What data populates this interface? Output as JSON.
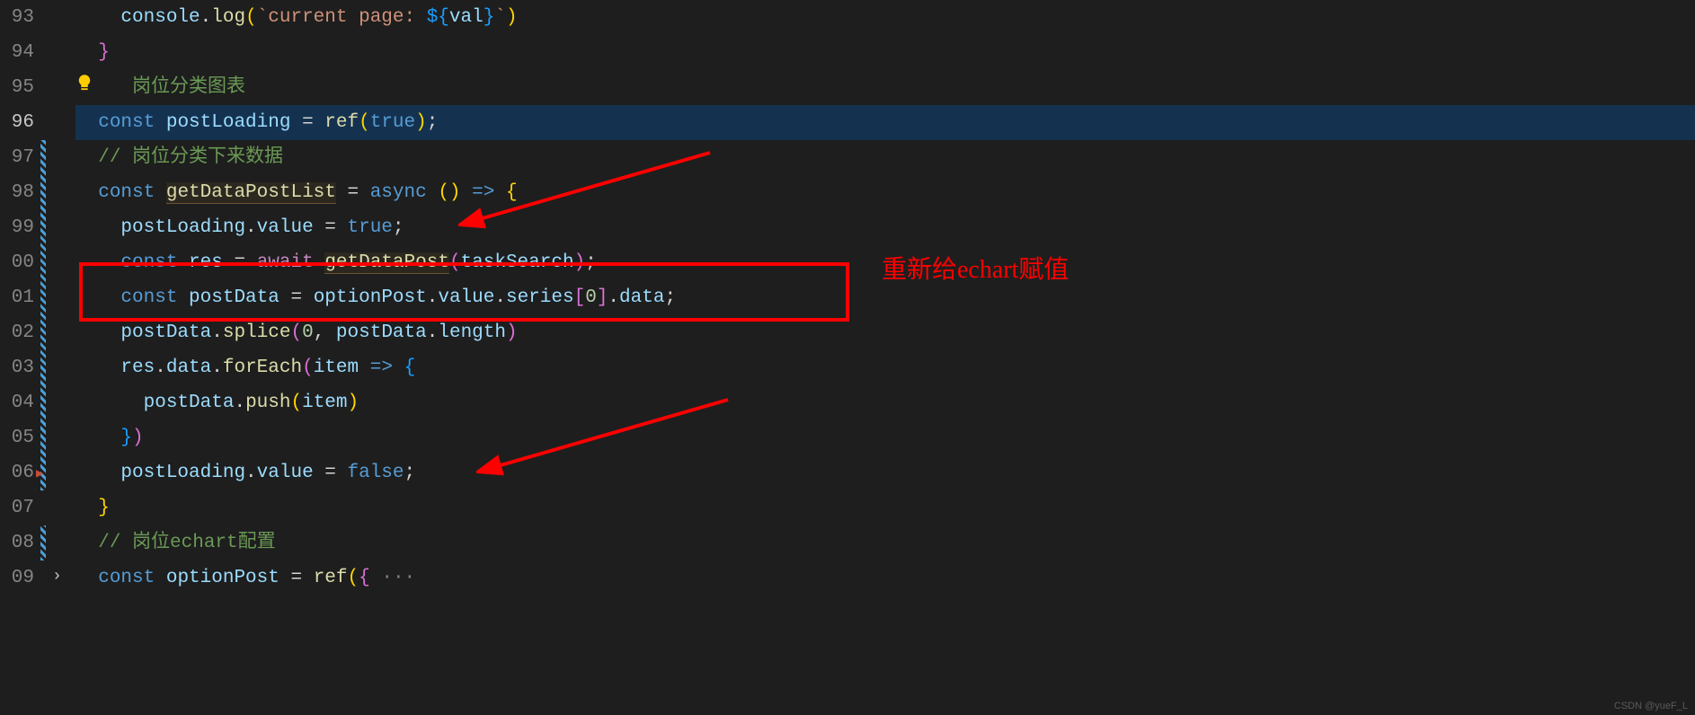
{
  "lines": [
    {
      "num": "93",
      "indent": "    ",
      "tokens": [
        {
          "t": "var",
          "v": "console"
        },
        {
          "t": "punct",
          "v": "."
        },
        {
          "t": "func",
          "v": "log"
        },
        {
          "t": "punct-yellow",
          "v": "("
        },
        {
          "t": "string",
          "v": "`current page: "
        },
        {
          "t": "punct-blue",
          "v": "${"
        },
        {
          "t": "var",
          "v": "val"
        },
        {
          "t": "punct-blue",
          "v": "}"
        },
        {
          "t": "string",
          "v": "`"
        },
        {
          "t": "punct-yellow",
          "v": ")"
        }
      ]
    },
    {
      "num": "94",
      "indent": "  ",
      "tokens": [
        {
          "t": "punct-pink",
          "v": "}"
        }
      ]
    },
    {
      "num": "95",
      "indent": "  ",
      "tokens": [
        {
          "t": "comment",
          "v": "   岗位分类图表"
        }
      ]
    },
    {
      "num": "96",
      "indent": "  ",
      "highlighted": true,
      "tokens": [
        {
          "t": "const",
          "v": "const"
        },
        {
          "t": "default",
          "v": " "
        },
        {
          "t": "var",
          "v": "postLoading"
        },
        {
          "t": "default",
          "v": " "
        },
        {
          "t": "operator",
          "v": "="
        },
        {
          "t": "default",
          "v": " "
        },
        {
          "t": "func",
          "v": "ref"
        },
        {
          "t": "punct-yellow",
          "v": "("
        },
        {
          "t": "bool",
          "v": "true"
        },
        {
          "t": "punct-yellow",
          "v": ")"
        },
        {
          "t": "punct",
          "v": ";"
        }
      ]
    },
    {
      "num": "97",
      "indent": "  ",
      "tokens": [
        {
          "t": "comment",
          "v": "// 岗位分类下来数据"
        }
      ]
    },
    {
      "num": "98",
      "indent": "  ",
      "tokens": [
        {
          "t": "const",
          "v": "const"
        },
        {
          "t": "default",
          "v": " "
        },
        {
          "t": "func-underline",
          "v": "getDataPostList"
        },
        {
          "t": "default",
          "v": " "
        },
        {
          "t": "operator",
          "v": "="
        },
        {
          "t": "default",
          "v": " "
        },
        {
          "t": "keyword",
          "v": "async"
        },
        {
          "t": "default",
          "v": " "
        },
        {
          "t": "punct-yellow",
          "v": "()"
        },
        {
          "t": "default",
          "v": " "
        },
        {
          "t": "keyword",
          "v": "=>"
        },
        {
          "t": "default",
          "v": " "
        },
        {
          "t": "punct-yellow",
          "v": "{"
        }
      ]
    },
    {
      "num": "99",
      "indent": "    ",
      "tokens": [
        {
          "t": "var",
          "v": "postLoading"
        },
        {
          "t": "punct",
          "v": "."
        },
        {
          "t": "prop",
          "v": "value"
        },
        {
          "t": "default",
          "v": " "
        },
        {
          "t": "operator",
          "v": "="
        },
        {
          "t": "default",
          "v": " "
        },
        {
          "t": "bool",
          "v": "true"
        },
        {
          "t": "punct",
          "v": ";"
        }
      ]
    },
    {
      "num": "00",
      "indent": "    ",
      "tokens": [
        {
          "t": "const",
          "v": "const"
        },
        {
          "t": "default",
          "v": " "
        },
        {
          "t": "var",
          "v": "res"
        },
        {
          "t": "default",
          "v": " "
        },
        {
          "t": "operator",
          "v": "="
        },
        {
          "t": "default",
          "v": " "
        },
        {
          "t": "keyword-control",
          "v": "await"
        },
        {
          "t": "default",
          "v": " "
        },
        {
          "t": "func-underline",
          "v": "getDataPost"
        },
        {
          "t": "punct-pink",
          "v": "("
        },
        {
          "t": "var",
          "v": "taskSearch"
        },
        {
          "t": "punct-pink",
          "v": ")"
        },
        {
          "t": "punct",
          "v": ";"
        }
      ]
    },
    {
      "num": "01",
      "indent": "    ",
      "tokens": [
        {
          "t": "const",
          "v": "const"
        },
        {
          "t": "default",
          "v": " "
        },
        {
          "t": "var",
          "v": "postData"
        },
        {
          "t": "default",
          "v": " "
        },
        {
          "t": "operator",
          "v": "="
        },
        {
          "t": "default",
          "v": " "
        },
        {
          "t": "var",
          "v": "optionPost"
        },
        {
          "t": "punct",
          "v": "."
        },
        {
          "t": "prop",
          "v": "value"
        },
        {
          "t": "punct",
          "v": "."
        },
        {
          "t": "prop",
          "v": "series"
        },
        {
          "t": "punct-pink",
          "v": "["
        },
        {
          "t": "number",
          "v": "0"
        },
        {
          "t": "punct-pink",
          "v": "]"
        },
        {
          "t": "punct",
          "v": "."
        },
        {
          "t": "prop",
          "v": "data"
        },
        {
          "t": "punct",
          "v": ";"
        }
      ]
    },
    {
      "num": "02",
      "indent": "    ",
      "tokens": [
        {
          "t": "var",
          "v": "postData"
        },
        {
          "t": "punct",
          "v": "."
        },
        {
          "t": "func",
          "v": "splice"
        },
        {
          "t": "punct-pink",
          "v": "("
        },
        {
          "t": "number",
          "v": "0"
        },
        {
          "t": "punct",
          "v": ", "
        },
        {
          "t": "var",
          "v": "postData"
        },
        {
          "t": "punct",
          "v": "."
        },
        {
          "t": "prop",
          "v": "length"
        },
        {
          "t": "punct-pink",
          "v": ")"
        }
      ]
    },
    {
      "num": "03",
      "indent": "    ",
      "tokens": [
        {
          "t": "var",
          "v": "res"
        },
        {
          "t": "punct",
          "v": "."
        },
        {
          "t": "prop",
          "v": "data"
        },
        {
          "t": "punct",
          "v": "."
        },
        {
          "t": "func",
          "v": "forEach"
        },
        {
          "t": "punct-pink",
          "v": "("
        },
        {
          "t": "var",
          "v": "item"
        },
        {
          "t": "default",
          "v": " "
        },
        {
          "t": "keyword",
          "v": "=>"
        },
        {
          "t": "default",
          "v": " "
        },
        {
          "t": "punct-blue",
          "v": "{"
        }
      ]
    },
    {
      "num": "04",
      "indent": "      ",
      "tokens": [
        {
          "t": "var",
          "v": "postData"
        },
        {
          "t": "punct",
          "v": "."
        },
        {
          "t": "func",
          "v": "push"
        },
        {
          "t": "punct-yellow",
          "v": "("
        },
        {
          "t": "var",
          "v": "item"
        },
        {
          "t": "punct-yellow",
          "v": ")"
        }
      ]
    },
    {
      "num": "05",
      "indent": "    ",
      "tokens": [
        {
          "t": "punct-blue",
          "v": "}"
        },
        {
          "t": "punct-pink",
          "v": ")"
        }
      ]
    },
    {
      "num": "06",
      "indent": "    ",
      "tokens": [
        {
          "t": "var",
          "v": "postLoading"
        },
        {
          "t": "punct",
          "v": "."
        },
        {
          "t": "prop",
          "v": "value"
        },
        {
          "t": "default",
          "v": " "
        },
        {
          "t": "operator",
          "v": "="
        },
        {
          "t": "default",
          "v": " "
        },
        {
          "t": "bool",
          "v": "false"
        },
        {
          "t": "punct",
          "v": ";"
        }
      ]
    },
    {
      "num": "07",
      "indent": "  ",
      "tokens": [
        {
          "t": "punct-yellow",
          "v": "}"
        }
      ]
    },
    {
      "num": "08",
      "indent": "  ",
      "tokens": [
        {
          "t": "comment",
          "v": "// 岗位echart配置"
        }
      ]
    },
    {
      "num": "09",
      "indent": "  ",
      "tokens": [
        {
          "t": "const",
          "v": "const"
        },
        {
          "t": "default",
          "v": " "
        },
        {
          "t": "var",
          "v": "optionPost"
        },
        {
          "t": "default",
          "v": " "
        },
        {
          "t": "operator",
          "v": "="
        },
        {
          "t": "default",
          "v": " "
        },
        {
          "t": "func",
          "v": "ref"
        },
        {
          "t": "punct-yellow",
          "v": "("
        },
        {
          "t": "punct-pink",
          "v": "{"
        },
        {
          "t": "dots",
          "v": " ···"
        }
      ]
    }
  ],
  "annotation": "重新给echart赋值",
  "watermark": "CSDN @yueF_L"
}
